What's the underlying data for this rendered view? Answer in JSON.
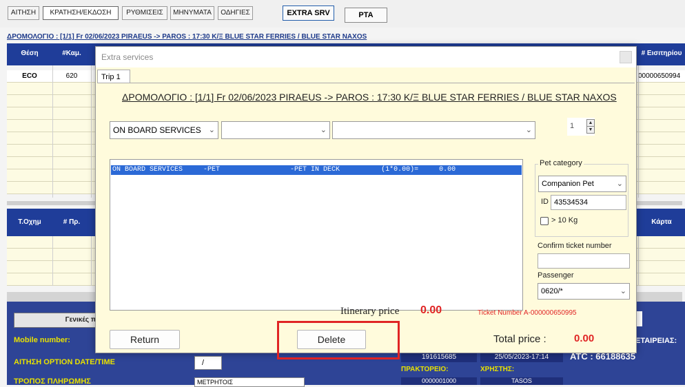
{
  "top_tabs": [
    "ΑΙΤΗΣΗ",
    "ΚΡΑΤΗΣΗ/ΕΚΔΟΣΗ",
    "ΡΥΘΜΙΣΕΙΣ",
    "ΜΗΝΥΜΑΤΑ",
    "ΟΔΗΓΙΕΣ"
  ],
  "srv_buttons": {
    "extra": "EXTRA SRV",
    "pta": "PTA"
  },
  "route_line": "ΔΡΟΜΟΛΟΓΙΟ : [1/1]  Fr 02/06/2023   PIRAEUS -> PAROS : 17:30   Κ/Ξ BLUE STAR  FERRIES  /  BLUE STAR NAXOS",
  "upper_grid": {
    "headers": {
      "seat": "Θέση",
      "cabin": "#Καμ.",
      "ticket_col": "# Εισιτηρίου"
    },
    "row": {
      "seat": "ECO",
      "cabin": "620",
      "ticket": "00000650994"
    }
  },
  "lower_grid": {
    "headers": {
      "vehicle": "Τ.Οχημ",
      "count": "# Πρ.",
      "card": "Κάρτα"
    }
  },
  "bottom_panel": {
    "general": "Γενικές πο",
    "mobile_label": "Mobile number:",
    "option_label": "ΑΙΤΗΣΗ OPTION DATE/TIME",
    "payment_label": "ΤΡΟΠΟΣ ΠΛΗΡΩΜΗΣ",
    "date_field": "/",
    "payment_field": "ΜΕΤΡΗΤΟΙΣ",
    "code1": "191615685",
    "datetime1": "25/05/2023-17:14",
    "company_label": "ΕΤΑΙΡΕΙΑΣ:",
    "atc": "ATC  : 66188635",
    "agency_label": "ΠΡΑΚΤΟΡΕΙΟ:",
    "user_label": "ΧΡΗΣΤΗΣ:",
    "agency_value": "0000001000",
    "user_value": "TASOS"
  },
  "dialog": {
    "title": "Extra services",
    "tab": "Trip 1",
    "route": "ΔΡΟΜΟΛΟΓΙΟ : [1/1]  Fr 02/06/2023    PIRAEUS -> PAROS : 17:30    Κ/Ξ BLUE STAR FERRIES  /  BLUE STAR NAXOS",
    "category_select": "ON BOARD SERVICES",
    "subcategory_select": "",
    "item_select": "",
    "quantity": "1",
    "list_row": "ON BOARD SERVICES     -PET                 -PET IN DECK          (1*0.00)=     0.00",
    "pet_category_label": "Pet category",
    "pet_category_value": "Companion Pet",
    "id_label": "ID",
    "id_value": "43534534",
    "weight_label": "> 10 Kg",
    "confirm_label": "Confirm ticket number",
    "confirm_value": "",
    "passenger_label": "Passenger",
    "passenger_value": "0620/*",
    "itinerary_label": "Itinerary price",
    "itinerary_value": "0.00",
    "ticket_number": "Ticket Number A-000000650995",
    "return_button": "Return",
    "delete_button": "Delete",
    "total_label": "Total price :",
    "total_value": "0.00"
  },
  "colors": {
    "grid_header": "#1f3d99",
    "accent_red": "#e02424",
    "selection_blue": "#2b69d6",
    "dialog_bg": "#fffbdc"
  }
}
